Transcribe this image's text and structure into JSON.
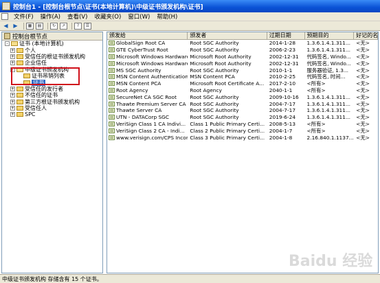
{
  "window": {
    "title": "控制台1 - [控制台根节点\\证书(本地计算机)\\中级证书颁发机构\\证书]"
  },
  "menu": [
    "文件(F)",
    "操作(A)",
    "查看(V)",
    "收藏夹(O)",
    "窗口(W)",
    "帮助(H)"
  ],
  "tree": {
    "header": "控制台根节点",
    "items": [
      {
        "label": "证书 (本地计算机)",
        "expander": "-",
        "level": 1
      },
      {
        "label": "个人",
        "expander": "+",
        "level": 2
      },
      {
        "label": "受信任的根证书颁发机构",
        "expander": "+",
        "level": 2
      },
      {
        "label": "企业信任",
        "expander": "+",
        "level": 2
      },
      {
        "label": "中级证书颁发机构",
        "expander": "-",
        "level": 2
      },
      {
        "label": "证书吊销列表",
        "expander": "",
        "level": 3
      },
      {
        "label": "证书",
        "expander": "",
        "level": 3,
        "selected": true
      },
      {
        "label": "受信任的发行者",
        "expander": "+",
        "level": 2
      },
      {
        "label": "不信任的证书",
        "expander": "+",
        "level": 2
      },
      {
        "label": "第三方根证书颁发机构",
        "expander": "+",
        "level": 2
      },
      {
        "label": "受信任人",
        "expander": "+",
        "level": 2
      },
      {
        "label": "SPC",
        "expander": "+",
        "level": 2
      }
    ]
  },
  "list": {
    "columns": [
      "颁发给",
      "颁发者",
      "过期日期",
      "预期目的",
      "好记的名称"
    ],
    "rows": [
      [
        "GlobalSign Root CA",
        "Root SGC Authority",
        "2014-1-28",
        "1.3.6.1.4.1.311...",
        "<无>"
      ],
      [
        "GTE CyberTrust Root",
        "Root SGC Authority",
        "2006-2-23",
        "1.3.6.1.4.1.311...",
        "<无>"
      ],
      [
        "Microsoft Windows Hardware...",
        "Microsoft Root Authority",
        "2002-12-31",
        "代码签名, Windo...",
        "<无>"
      ],
      [
        "Microsoft Windows Hardware...",
        "Microsoft Root Authority",
        "2002-12-31",
        "代码签名, Windo...",
        "<无>"
      ],
      [
        "MS SGC Authority",
        "Root SGC Authority",
        "2010-1-1",
        "服务器验证, 1.3...",
        "<无>"
      ],
      [
        "MSN Content Authentication CA",
        "MSN Content PCA",
        "2010-2-25",
        "代码签名, 时间...",
        "<无>"
      ],
      [
        "MSN Content PCA",
        "Microsoft Root Certificate A...",
        "2017-2-10",
        "<所有>",
        "<无>"
      ],
      [
        "Root Agency",
        "Root Agency",
        "2040-1-1",
        "<所有>",
        "<无>"
      ],
      [
        "SecureNet CA SGC Root",
        "Root SGC Authority",
        "2009-10-16",
        "1.3.6.1.4.1.311...",
        "<无>"
      ],
      [
        "Thawte Premium Server CA",
        "Root SGC Authority",
        "2004-7-17",
        "1.3.6.1.4.1.311...",
        "<无>"
      ],
      [
        "Thawte Server CA",
        "Root SGC Authority",
        "2004-7-17",
        "1.3.6.1.4.1.311...",
        "<无>"
      ],
      [
        "UTN - DATACorp SGC",
        "Root SGC Authority",
        "2019-6-24",
        "1.3.6.1.4.1.311...",
        "<无>"
      ],
      [
        "VeriSign Class 1 CA Indivi...",
        "Class 1 Public Primary Certi...",
        "2008-5-13",
        "<所有>",
        "<无>"
      ],
      [
        "VeriSign Class 2 CA - Indi...",
        "Class 2 Public Primary Certi...",
        "2004-1-7",
        "<所有>",
        "<无>"
      ],
      [
        "www.verisign.com/CPS Incor...",
        "Class 3 Public Primary Certi...",
        "2004-1-8",
        "2.16.840.1.1137...",
        "<无>"
      ]
    ]
  },
  "status": "中级证书颁发机构 存储含有 15 个证书。",
  "watermark": "Baidu 经验"
}
